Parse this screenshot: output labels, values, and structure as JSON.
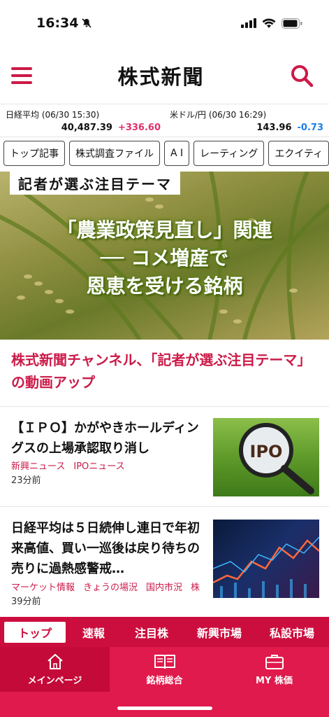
{
  "status": {
    "time": "16:34"
  },
  "header": {
    "logo": "株式新聞"
  },
  "ticker": {
    "nikkei": {
      "label": "日経平均 (06/30 15:30)",
      "value": "40,487.39",
      "change": "+336.60"
    },
    "usdjpy": {
      "label": "米ドル/円 (06/30 16:29)",
      "value": "143.96",
      "change": "-0.73"
    }
  },
  "chips": [
    "トップ記事",
    "株式調査ファイル",
    "A I",
    "レーティング",
    "エクイティ"
  ],
  "hero": {
    "label": "記者が選ぶ注目テーマ",
    "lines": [
      "「農業政策見直し」関連",
      "── コメ増産で",
      "恩恵を受ける銘柄"
    ]
  },
  "headline": "株式新聞チャンネル、「記者が選ぶ注目テーマ」の動画アップ",
  "articles": [
    {
      "title": "【ＩＰＯ】かがやきホールディングスの上場承認取り消し",
      "tags": [
        "新興ニュース",
        "IPOニュース"
      ],
      "time": "23分前",
      "thumb_text": "IPO"
    },
    {
      "title": "日経平均は５日続伸し連日で年初来高値、買い一巡後は戻り待ちの売りに過熱感警戒…",
      "tags": [
        "マーケット情報",
        "きょうの場況",
        "国内市況",
        "株"
      ],
      "time": "39分前"
    }
  ],
  "nav_tabs": [
    "トップ",
    "速報",
    "注目株",
    "新興市場",
    "私設市場"
  ],
  "bottom_nav": [
    "メインページ",
    "銘柄総合",
    "MY 株価"
  ],
  "colors": {
    "brand": "#cc1a48",
    "positive": "#e0306a",
    "negative": "#1a7ee6"
  }
}
